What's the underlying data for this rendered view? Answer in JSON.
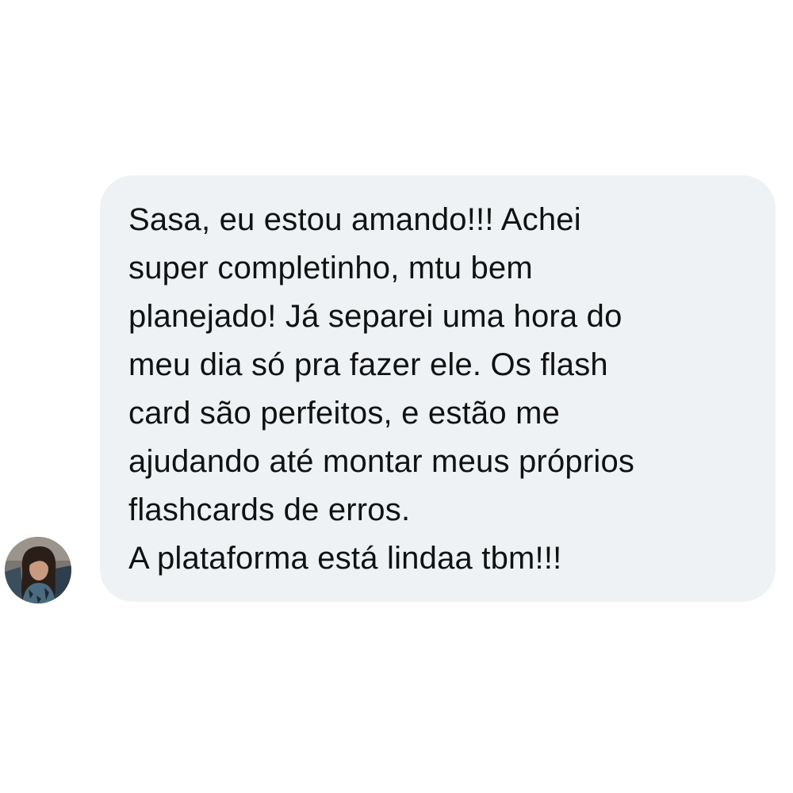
{
  "conversation": {
    "message": {
      "lines": [
        "Sasa, eu estou amando!!! Achei",
        "super completinho, mtu bem",
        "planejado! Já separei uma hora do",
        "meu dia só pra fazer ele. Os flash",
        "card são perfeitos, e estão me",
        "ajudando até montar meus próprios",
        "flashcards de erros.",
        "A plataforma está lindaa tbm!!!"
      ]
    },
    "avatar": {
      "icon": "user-avatar-photo"
    }
  },
  "colors": {
    "bubble_background": "#eff2f4",
    "text": "#111111",
    "page_background": "#ffffff"
  }
}
